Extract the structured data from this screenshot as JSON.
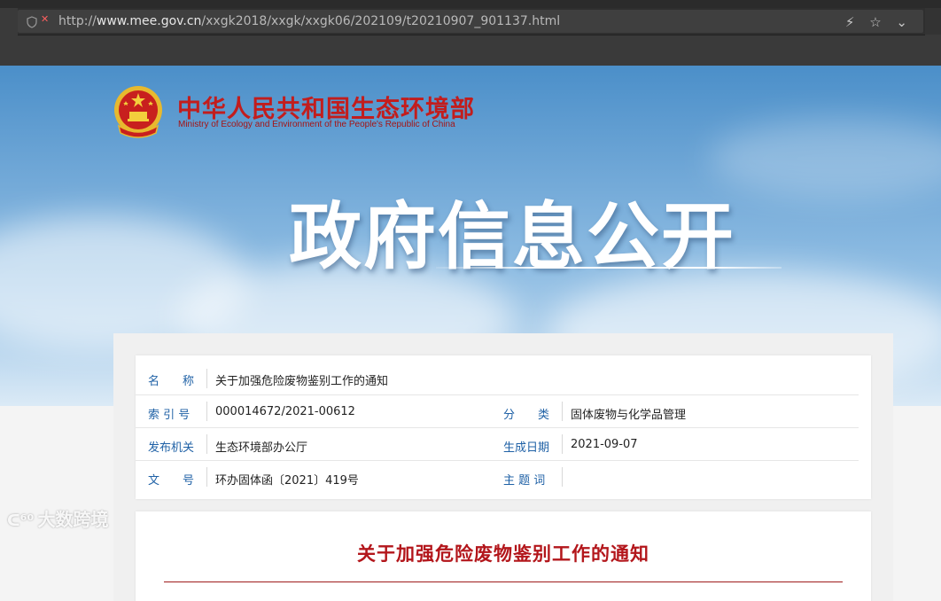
{
  "browser": {
    "url_prefix": "http://",
    "url_host": "www.mee.gov.cn",
    "url_path": "/xxgk2018/xxgk/xxgk06/202109/t20210907_901137.html",
    "icons": [
      "security-shield-icon",
      "reader-mode-icon",
      "bookmark-star-icon",
      "dropdown-icon"
    ]
  },
  "header": {
    "ministry_cn": "中华人民共和国生态环境部",
    "ministry_en": "Ministry of Ecology and Environment of the People's Republic of China",
    "banner_title": "政府信息公开"
  },
  "info": {
    "name_label": "名　　称",
    "name_value": "关于加强危险废物鉴别工作的通知",
    "index_label": "索 引 号",
    "index_value": "000014672/2021-00612",
    "category_label": "分　　类",
    "category_value": "固体废物与化学品管理",
    "issuer_label": "发布机关",
    "issuer_value": "生态环境部办公厅",
    "date_label": "生成日期",
    "date_value": "2021-09-07",
    "docno_label": "文　　号",
    "docno_value": "环办固体函〔2021〕419号",
    "subject_label": "主 题 词",
    "subject_value": ""
  },
  "document": {
    "title": "关于加强危险废物鉴别工作的通知"
  },
  "watermark": {
    "text": "大数跨境"
  },
  "colors": {
    "brand_red": "#c21d1d",
    "label_blue": "#1f61a6",
    "title_red": "#b3161b"
  }
}
